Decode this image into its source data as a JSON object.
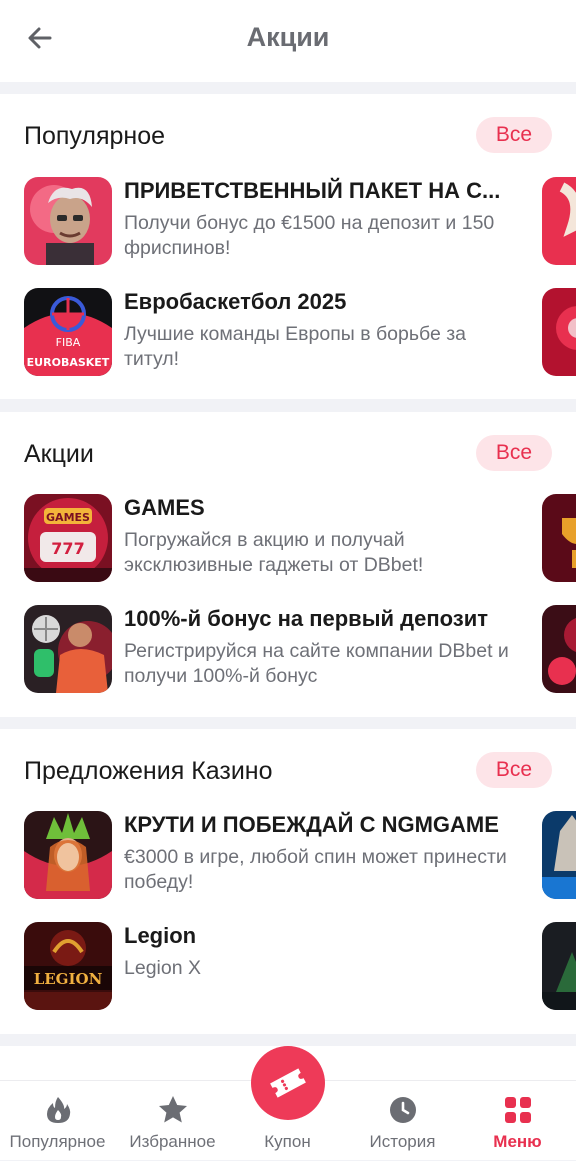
{
  "header": {
    "title": "Акции",
    "back_icon": "arrow-left-icon"
  },
  "sections": [
    {
      "title": "Популярное",
      "all_label": "Все",
      "items": [
        {
          "title": "ПРИВЕТСТВЕННЫЙ ПАКЕТ НА С...",
          "description": "Получи бонус до €1500 на депозит и 150 фриспинов!"
        },
        {
          "title": "Евробаскетбол 2025",
          "description": "Лучшие команды Европы в борьбе за титул!",
          "thumb_text": "EUROBASKET",
          "thumb_sub": "FIBA"
        }
      ]
    },
    {
      "title": "Акции",
      "all_label": "Все",
      "items": [
        {
          "title": "GAMES",
          "description": "Погружайся в акцию и получай эксклюзивные гаджеты от DBbet!",
          "thumb_text": "GAMES"
        },
        {
          "title": "100%-й бонус на первый депозит",
          "description": "Регистрируйся на сайте компании DBbet и получи 100%-й бонус"
        }
      ]
    },
    {
      "title": "Предложения Казино",
      "all_label": "Все",
      "items": [
        {
          "title": "КРУТИ И ПОБЕЖДАЙ С NGMGAME",
          "description": "€3000 в игре, любой спин может принести победу!"
        },
        {
          "title": "Legion",
          "description": "Legion X",
          "thumb_text": "LEGION"
        }
      ]
    }
  ],
  "bottom_nav": {
    "items": [
      {
        "label": "Популярное",
        "icon": "flame-icon"
      },
      {
        "label": "Избранное",
        "icon": "star-icon"
      },
      {
        "label": "Купон",
        "icon": "ticket-icon"
      },
      {
        "label": "История",
        "icon": "clock-icon"
      },
      {
        "label": "Меню",
        "icon": "grid-icon"
      }
    ],
    "active_index": 4
  },
  "colors": {
    "accent": "#e8304f",
    "badge_bg": "#fde4e8",
    "background": "#f1f2f6"
  }
}
